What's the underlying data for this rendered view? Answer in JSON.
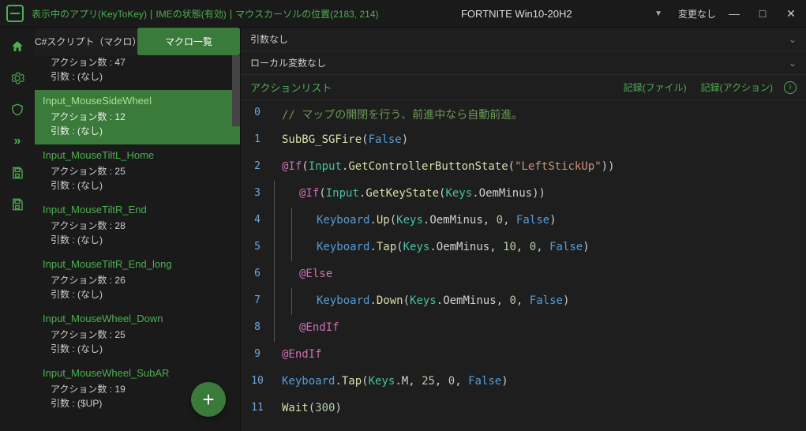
{
  "titlebar": {
    "info1": "表示中のアプリ(KeyToKey)",
    "info2": "IMEの状態(有効)",
    "info3": "マウスカーソルの位置(2183, 214)",
    "center": "FORTNITE Win10-20H2",
    "change": "変更なし"
  },
  "tabs": {
    "script": "C#スクリプト（マクロ）",
    "list": "マクロ一覧"
  },
  "macros": {
    "partial": {
      "actions": "アクション数  :  47",
      "args": "引数  :  (なし)"
    },
    "selected": {
      "name": "Input_MouseSideWheel",
      "actions": "アクション数  :  12",
      "args": "引数  :  (なし)"
    },
    "items": [
      {
        "name": "Input_MouseTiltL_Home",
        "actions": "アクション数  :  25",
        "args": "引数  :  (なし)"
      },
      {
        "name": "Input_MouseTiltR_End",
        "actions": "アクション数  :  28",
        "args": "引数  :  (なし)"
      },
      {
        "name": "Input_MouseTiltR_End_long",
        "actions": "アクション数  :  26",
        "args": "引数  :  (なし)"
      },
      {
        "name": "Input_MouseWheel_Down",
        "actions": "アクション数  :  25",
        "args": "引数  :  (なし)"
      },
      {
        "name": "Input_MouseWheel_SubAR",
        "actions": "アクション数  :  19",
        "args": "引数  :  ($UP)"
      }
    ]
  },
  "header": {
    "args": "引数なし",
    "locals": "ローカル変数なし",
    "actionlist": "アクションリスト",
    "recfile": "記録(ファイル)",
    "recaction": "記録(アクション)"
  },
  "code": [
    {
      "n": "0",
      "indent": 0,
      "raw": "comment"
    },
    {
      "n": "1",
      "indent": 0,
      "raw": "l1"
    },
    {
      "n": "2",
      "indent": 0,
      "raw": "l2"
    },
    {
      "n": "3",
      "indent": 1,
      "raw": "l3"
    },
    {
      "n": "4",
      "indent": 2,
      "raw": "l4"
    },
    {
      "n": "5",
      "indent": 2,
      "raw": "l5"
    },
    {
      "n": "6",
      "indent": 1,
      "raw": "l6"
    },
    {
      "n": "7",
      "indent": 2,
      "raw": "l7"
    },
    {
      "n": "8",
      "indent": 1,
      "raw": "l8"
    },
    {
      "n": "9",
      "indent": 0,
      "raw": "l9"
    },
    {
      "n": "10",
      "indent": 0,
      "raw": "l10"
    },
    {
      "n": "11",
      "indent": 0,
      "raw": "l11"
    }
  ],
  "codeText": {
    "comment": "// マップの開閉を行う、前進中なら自動前進。",
    "subbg": "SubBG_SGFire",
    "false": "False",
    "if": "@If",
    "else": "@Else",
    "endif": "@EndIf",
    "input": "Input",
    "getctrl": "GetControllerButtonState",
    "leftstick": "\"LeftStickUp\"",
    "getkey": "GetKeyState",
    "keys": "Keys",
    "oemminus": "OemMinus",
    "keyboard": "Keyboard",
    "up": "Up",
    "tap": "Tap",
    "down": "Down",
    "m": "M",
    "wait": "Wait",
    "n0": "0",
    "n10": "10",
    "n25": "25",
    "n300": "300"
  }
}
